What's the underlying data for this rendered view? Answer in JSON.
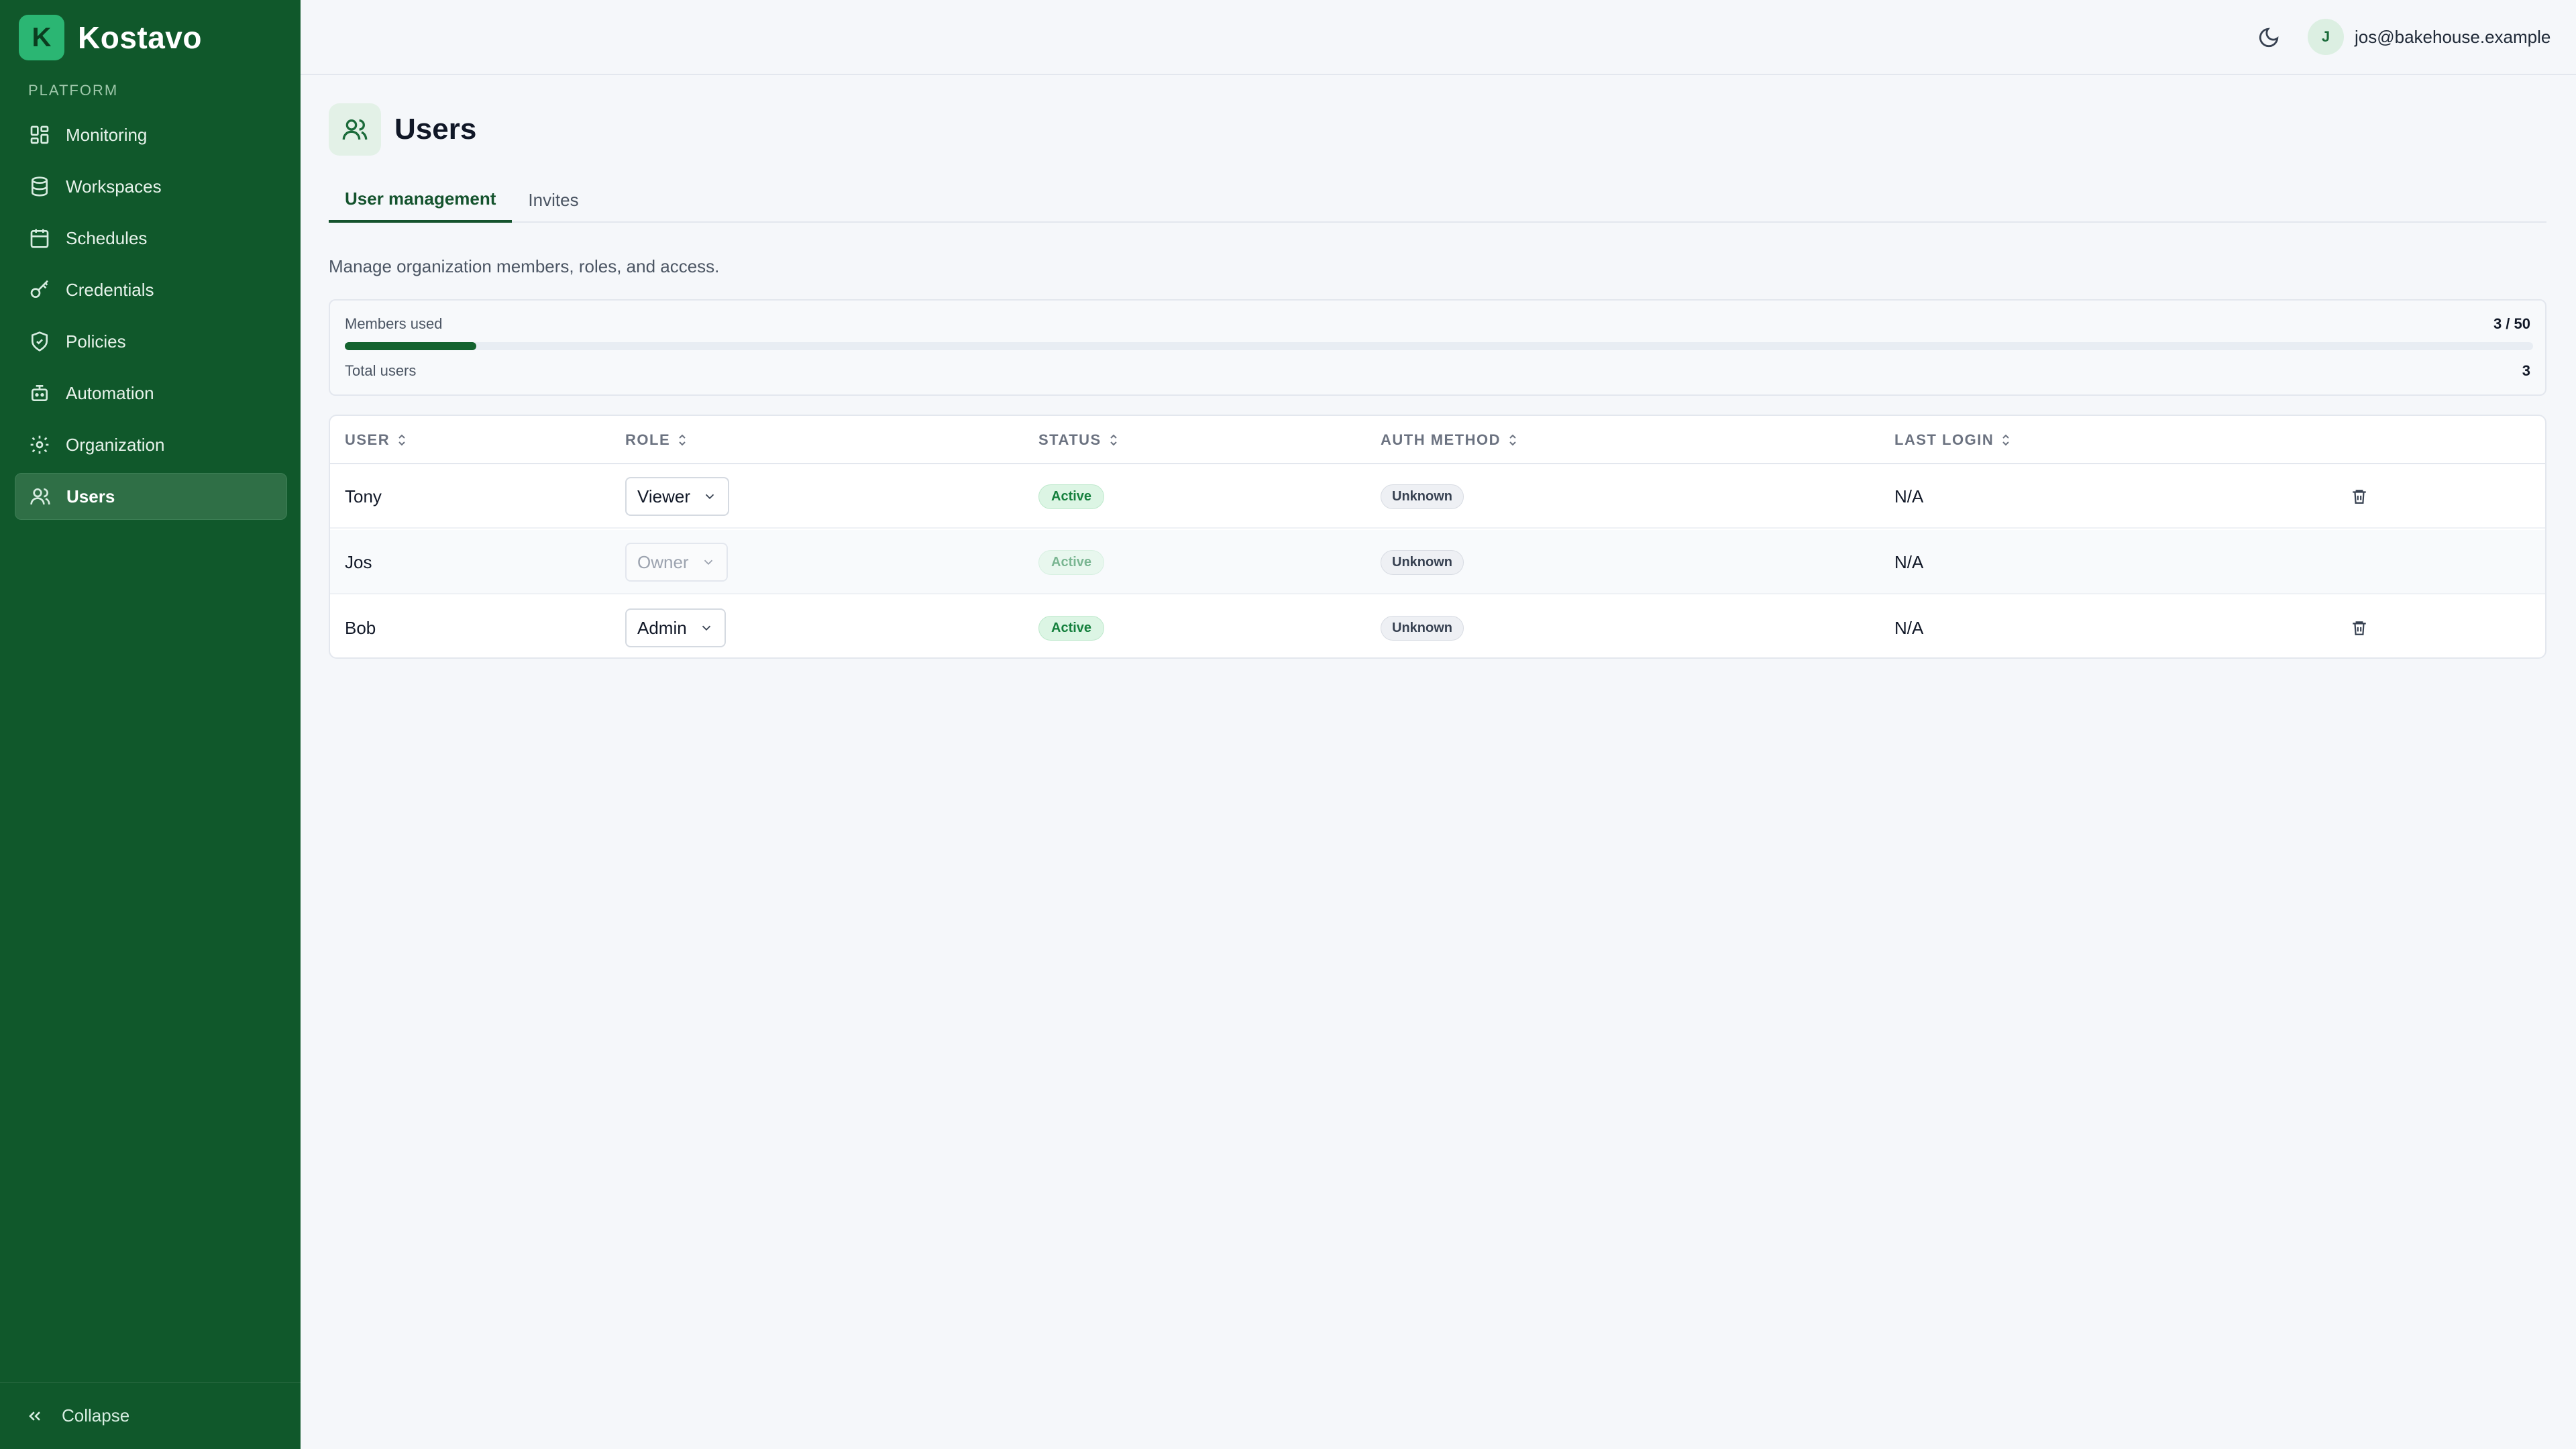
{
  "app": {
    "name": "Kostavo",
    "logo_letter": "K"
  },
  "sidebar": {
    "section_label": "PLATFORM",
    "items": [
      {
        "label": "Monitoring",
        "icon": "grid-icon"
      },
      {
        "label": "Workspaces",
        "icon": "database-icon"
      },
      {
        "label": "Schedules",
        "icon": "calendar-icon"
      },
      {
        "label": "Credentials",
        "icon": "key-icon"
      },
      {
        "label": "Policies",
        "icon": "shield-icon"
      },
      {
        "label": "Automation",
        "icon": "bot-icon"
      },
      {
        "label": "Organization",
        "icon": "gear-icon"
      },
      {
        "label": "Users",
        "icon": "users-icon",
        "active": true
      }
    ],
    "collapse_label": "Collapse"
  },
  "header": {
    "avatar_initial": "J",
    "user_email": "jos@bakehouse.example"
  },
  "page": {
    "title": "Users",
    "tabs": [
      {
        "label": "User management",
        "active": true
      },
      {
        "label": "Invites",
        "active": false
      }
    ],
    "description": "Manage organization members, roles, and access."
  },
  "usage": {
    "members_label": "Members used",
    "members_value": "3 / 50",
    "members_fraction": 0.06,
    "total_label": "Total users",
    "total_value": "3"
  },
  "table": {
    "columns": [
      "USER",
      "ROLE",
      "STATUS",
      "AUTH METHOD",
      "LAST LOGIN"
    ],
    "rows": [
      {
        "user": "Tony",
        "role": "Viewer",
        "status": "Active",
        "auth": "Unknown",
        "last_login": "N/A",
        "editable": true
      },
      {
        "user": "Jos",
        "role": "Owner",
        "status": "Active",
        "auth": "Unknown",
        "last_login": "N/A",
        "editable": false
      },
      {
        "user": "Bob",
        "role": "Admin",
        "status": "Active",
        "auth": "Unknown",
        "last_login": "N/A",
        "editable": true
      }
    ]
  },
  "colors": {
    "sidebar_bg": "#10582b",
    "accent": "#14632f",
    "active_badge": "#15803d"
  }
}
